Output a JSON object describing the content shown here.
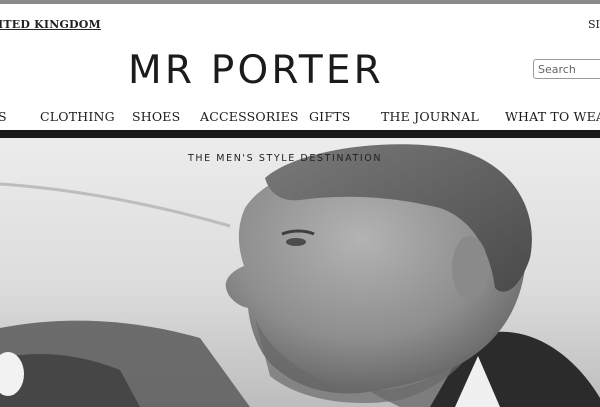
{
  "header": {
    "country_link": "ITED KINGDOM",
    "signin_link": "SI",
    "logo": "MR PORTER",
    "search": {
      "placeholder": "Search",
      "value": ""
    }
  },
  "nav": {
    "items": [
      {
        "label": "S"
      },
      {
        "label": "CLOTHING"
      },
      {
        "label": "SHOES"
      },
      {
        "label": "ACCESSORIES"
      },
      {
        "label": "GIFTS"
      },
      {
        "label": "THE JOURNAL"
      },
      {
        "label": "WHAT TO WEAR"
      }
    ]
  },
  "hero": {
    "tagline": "THE MEN'S STYLE DESTINATION",
    "image_subject": "black-and-white portrait photo"
  },
  "colors": {
    "text": "#1a1a1a",
    "nav_rule": "#1a1a1a",
    "hero_background": "#d9d9d9",
    "search_border": "#9a9a9a"
  }
}
